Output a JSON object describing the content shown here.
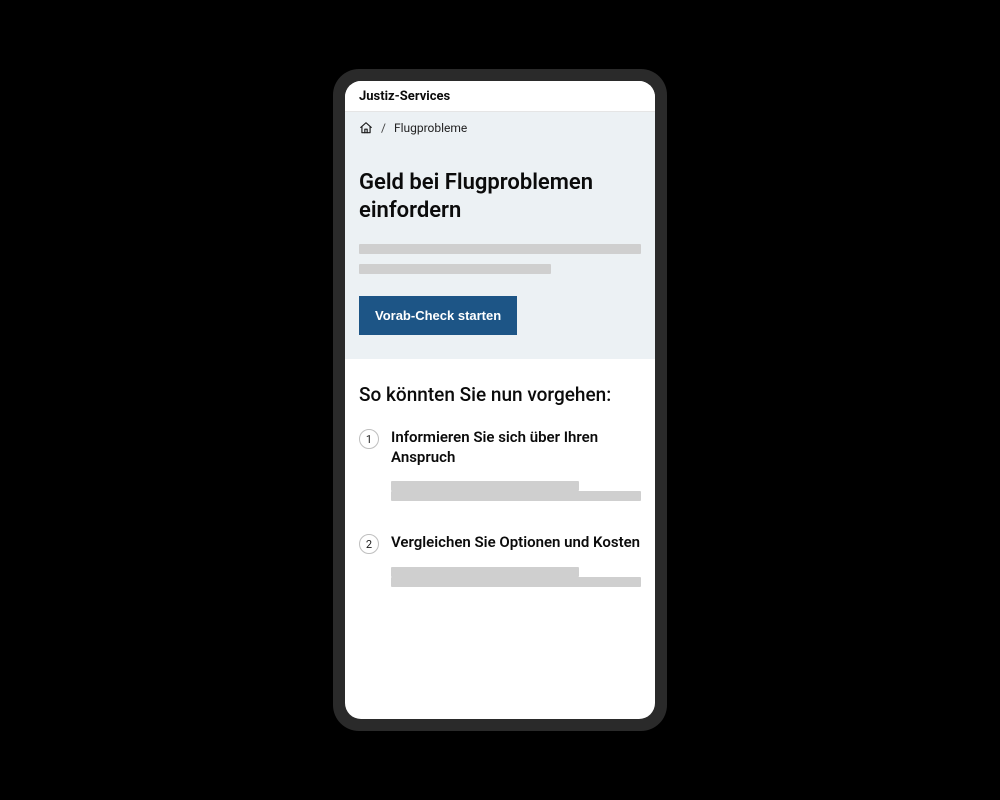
{
  "header": {
    "title": "Justiz-Services"
  },
  "breadcrumb": {
    "current": "Flugprobleme",
    "separator": "/"
  },
  "hero": {
    "title": "Geld bei Flugproblemen einfordern",
    "cta_label": "Vorab-Check starten"
  },
  "section": {
    "title": "So könnten Sie nun vorgehen:"
  },
  "steps": [
    {
      "num": "1",
      "title": "Informieren Sie sich über Ihren Anspruch"
    },
    {
      "num": "2",
      "title": "Vergleichen Sie Optionen und Kosten"
    }
  ]
}
